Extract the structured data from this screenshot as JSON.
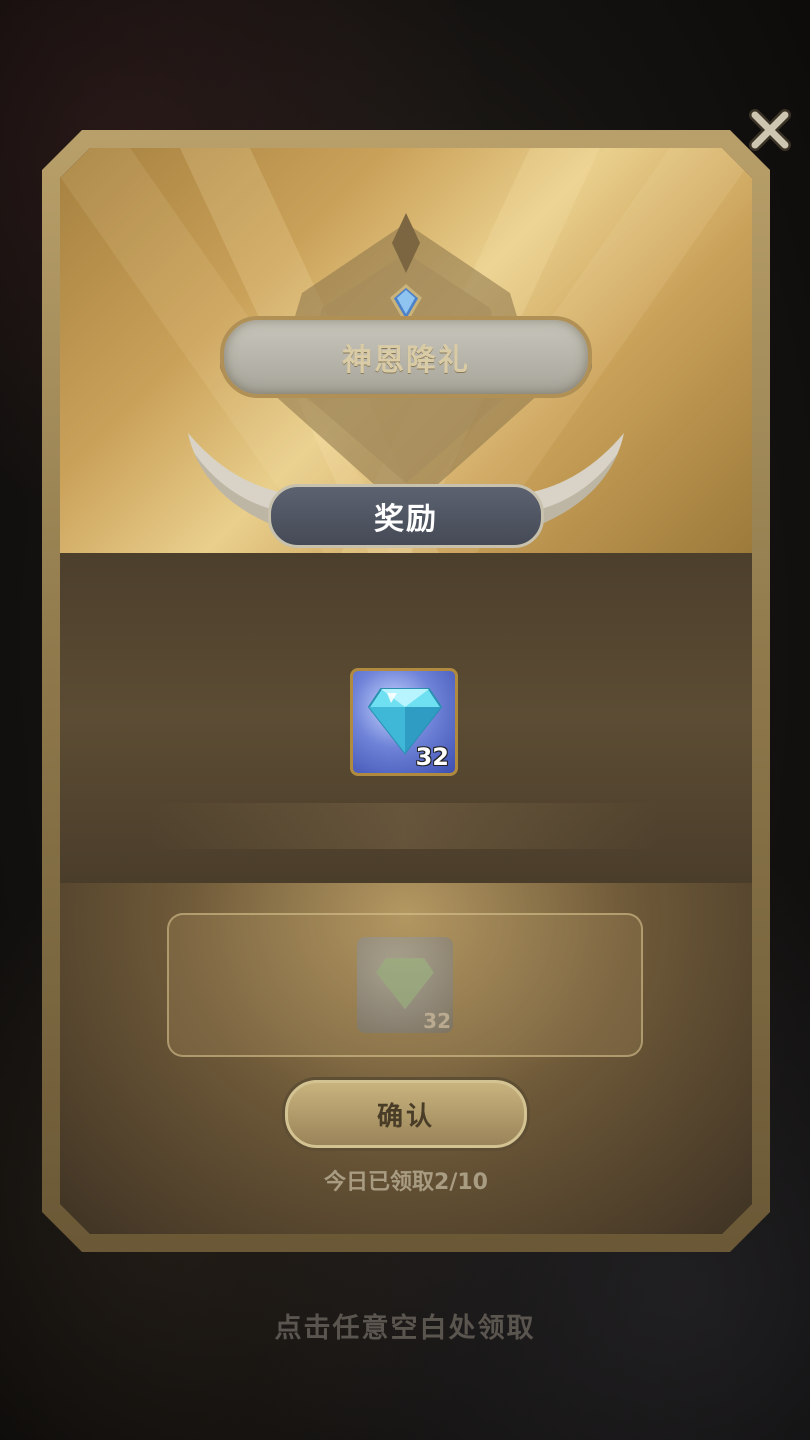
{
  "dialog": {
    "title": "神恩降礼",
    "section_label": "奖励",
    "reward": {
      "icon": "diamond-gem-icon",
      "count": "32"
    },
    "preview": {
      "icon": "diamond-gem-icon",
      "count": "32"
    },
    "confirm_label": "确认",
    "daily_status": "今日已领取2/10"
  },
  "hint": "点击任意空白处领取",
  "colors": {
    "gold_frame": "#b9a06a",
    "ribbon": "#4d5260",
    "text_white": "#ffffff"
  }
}
